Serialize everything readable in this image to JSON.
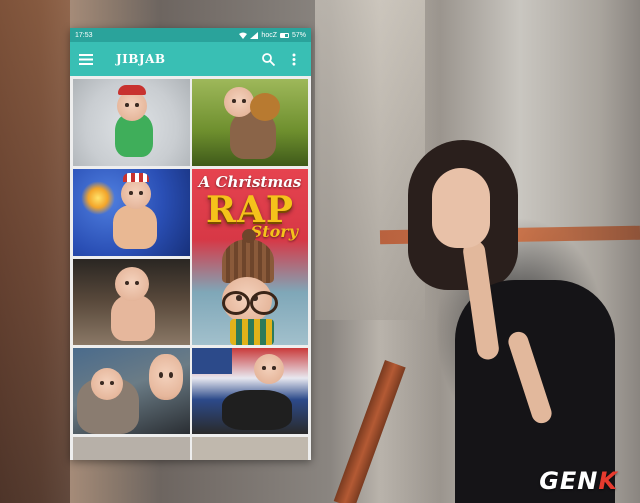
{
  "status_bar": {
    "time": "17:53",
    "carrier": "hocZ",
    "battery": "57%"
  },
  "app_bar": {
    "title": "JIBJAB",
    "menu_icon": "hamburger-menu-icon",
    "search_icon": "search-icon",
    "overflow_icon": "more-vert-icon"
  },
  "grid": {
    "featured_tile": {
      "line1": "A Christmas",
      "line2": "RAP",
      "line3": "Story"
    }
  },
  "watermark": {
    "brand": "GENK"
  },
  "colors": {
    "status_bar": "#2aa39b",
    "app_bar": "#39bfb4",
    "watermark_accent": "#e63a2e"
  }
}
